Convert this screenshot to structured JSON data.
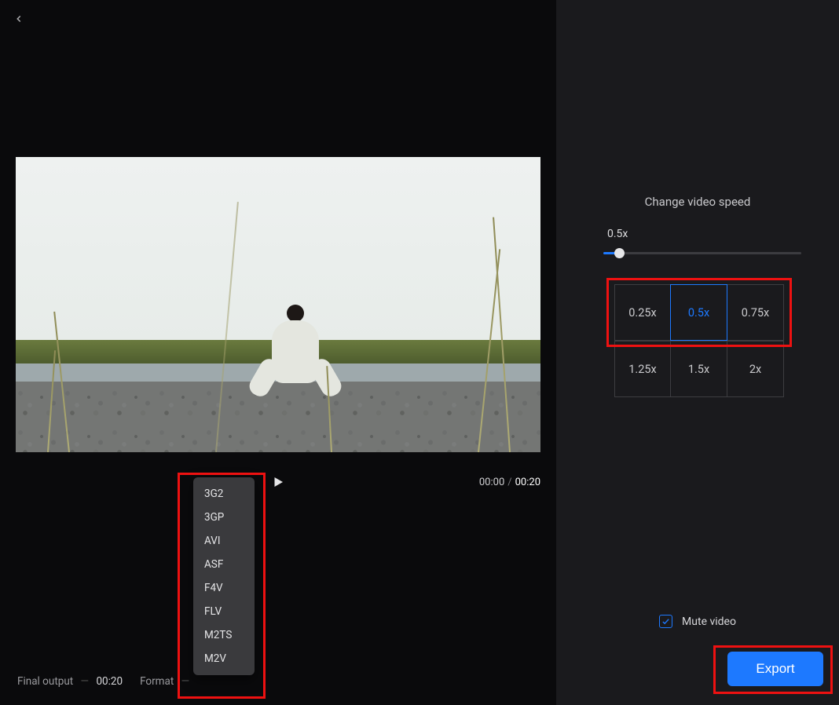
{
  "nav": {
    "back_icon": "chevron-left"
  },
  "playback": {
    "current_time": "00:00",
    "separator": "/",
    "total_time": "00:20"
  },
  "format_menu": {
    "items": [
      "3G2",
      "3GP",
      "AVI",
      "ASF",
      "F4V",
      "FLV",
      "M2TS",
      "M2V"
    ]
  },
  "bottom_bar": {
    "final_output_label": "Final output",
    "final_output_value": "00:20",
    "format_label": "Format"
  },
  "speed_panel": {
    "title": "Change video speed",
    "current_label": "0.5x",
    "slider_percent": 8,
    "presets_row1": [
      "0.25x",
      "0.5x",
      "0.75x"
    ],
    "presets_row2": [
      "1.25x",
      "1.5x",
      "2x"
    ],
    "selected": "0.5x"
  },
  "mute": {
    "label": "Mute video",
    "checked": true
  },
  "export": {
    "label": "Export"
  }
}
